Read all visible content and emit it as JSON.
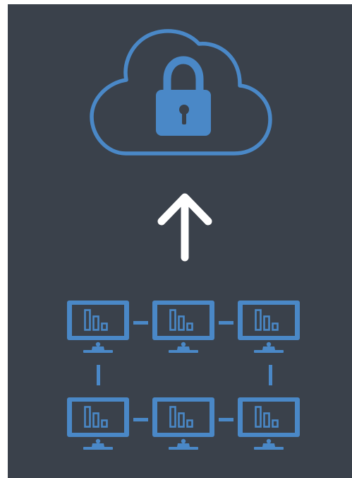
{
  "colors": {
    "background": "#3a414b",
    "accent": "#4a88c7",
    "arrow": "#ffffff"
  },
  "diagram": {
    "top_node": {
      "icon": "cloud-lock-icon"
    },
    "connection": {
      "icon": "arrow-up-icon",
      "direction": "up"
    },
    "network": {
      "node_icon": "monitor-chart-icon",
      "rows": 2,
      "columns": 3,
      "links": [
        [
          "r1c1",
          "r1c2"
        ],
        [
          "r1c2",
          "r1c3"
        ],
        [
          "r2c1",
          "r2c2"
        ],
        [
          "r2c2",
          "r2c3"
        ],
        [
          "r1c1",
          "r2c1"
        ],
        [
          "r1c3",
          "r2c3"
        ]
      ]
    }
  }
}
